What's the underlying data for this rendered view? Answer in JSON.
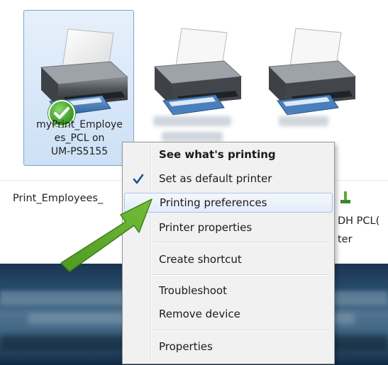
{
  "printers": [
    {
      "name_lines": [
        "myPrint_Employe",
        "es_PCL on",
        "UM-PS5155"
      ],
      "selected": true,
      "default": true,
      "status_icon": "default-printer-check-icon"
    },
    {
      "name_lines": [],
      "blurred": true
    },
    {
      "name_lines": [],
      "blurred": true
    }
  ],
  "strip": {
    "left_text": "Print_Employees_",
    "right_text_1": "DH PCL(",
    "right_text_2": "ter"
  },
  "context_menu": {
    "items": [
      {
        "id": "see-whats-printing",
        "label": "See what's printing",
        "bold": true
      },
      {
        "id": "set-default",
        "label": "Set as default printer",
        "checked": true
      },
      {
        "id": "printing-preferences",
        "label": "Printing preferences",
        "highlighted": true
      },
      {
        "id": "printer-properties",
        "label": "Printer properties"
      },
      {
        "id": "create-shortcut",
        "label": "Create shortcut"
      },
      {
        "id": "troubleshoot",
        "label": "Troubleshoot"
      },
      {
        "id": "remove-device",
        "label": "Remove device"
      },
      {
        "id": "properties",
        "label": "Properties"
      }
    ]
  },
  "colors": {
    "menu_bg": "#f1f1f1",
    "highlight_border": "#a6c5ea",
    "tile_selected_border": "#7da2ce",
    "arrow_green": "#5ca529",
    "check_green": "#3f9f2b"
  },
  "icons": {
    "printer": "printer-icon",
    "checkmark": "checkmark-icon",
    "arrow": "pointer-arrow"
  }
}
